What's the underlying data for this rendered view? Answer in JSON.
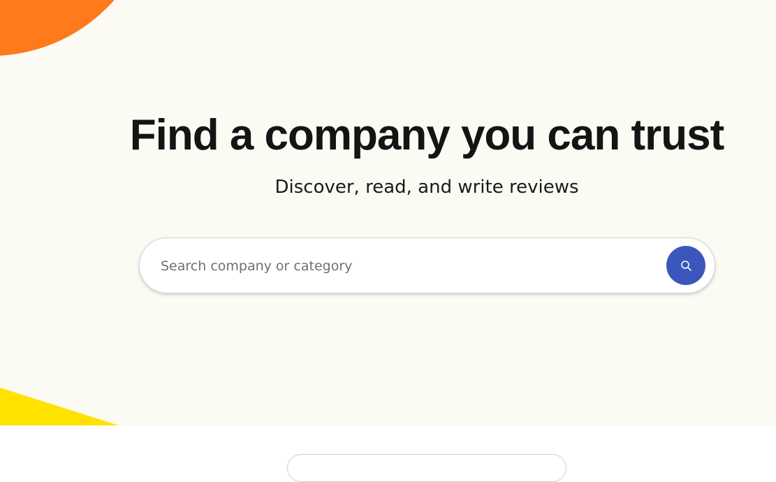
{
  "hero": {
    "headline": "Find a company you can trust",
    "subheadline": "Discover, read, and write reviews"
  },
  "search": {
    "placeholder": "Search company or category",
    "value": "",
    "button_icon": "search-icon"
  },
  "colors": {
    "hero_background": "#fbfaf3",
    "accent_orange": "#ff7a1a",
    "accent_yellow": "#ffe200",
    "search_button": "#3c57bc"
  }
}
